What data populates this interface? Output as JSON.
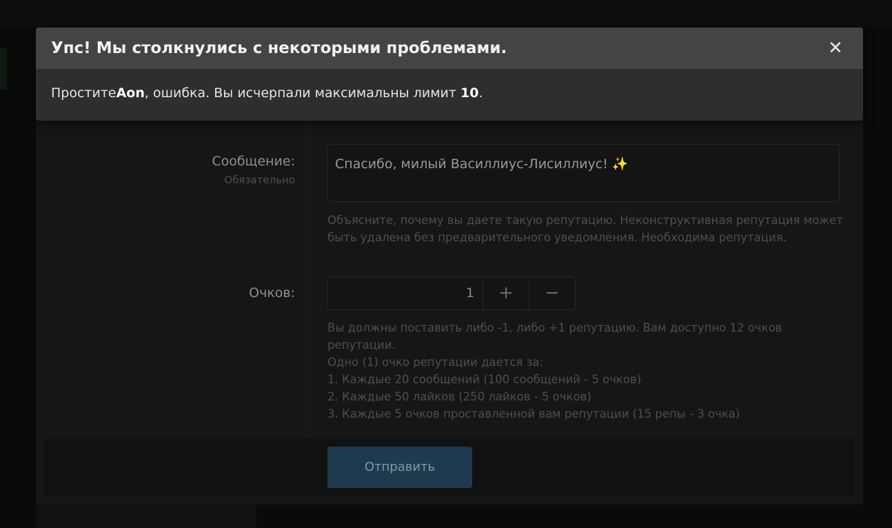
{
  "dialog": {
    "title": "Упс! Мы столкнулись с некоторыми проблемами.",
    "close_glyph": "✕",
    "message": {
      "prefix": "Простите",
      "username": "Aon",
      "middle": ", ошибка. Вы исчерпали максимальны лимит ",
      "limit": "10",
      "suffix": "."
    }
  },
  "form": {
    "message_label": "Сообщение:",
    "message_required": "Обязательно",
    "message_value": "Спасибо, милый Василлиус-Лисиллиус!",
    "message_emoji": "✨",
    "message_hint_lines": [
      "Объясните, почему вы даете такую репутацию. Неконструктивная репутация может",
      "быть удалена без предварительного уведомления. Необходима репутация."
    ],
    "points_label": "Очков:",
    "points_value": "1",
    "plus_glyph": "+",
    "minus_glyph": "−",
    "points_hint_lines": [
      "Вы должны поставить либо -1, либо +1 репутацию. Вам доступно 12 очков",
      "репутации.",
      "Одно (1) очко репутации дается за:",
      "1. Каждые 20 сообщений (100 сообщений - 5 очков)",
      "2. Каждые 50 лайков (250 лайков - 5 очков)",
      "3. Каждые 5 очков проставленной вам репутации (15 репы - 3 очка)"
    ],
    "submit_label": "Отправить"
  },
  "colors": {
    "submit_bg": "#1f3a4e",
    "dialog_header_bg": "#444444",
    "dialog_body_bg": "#2e2e2e"
  }
}
